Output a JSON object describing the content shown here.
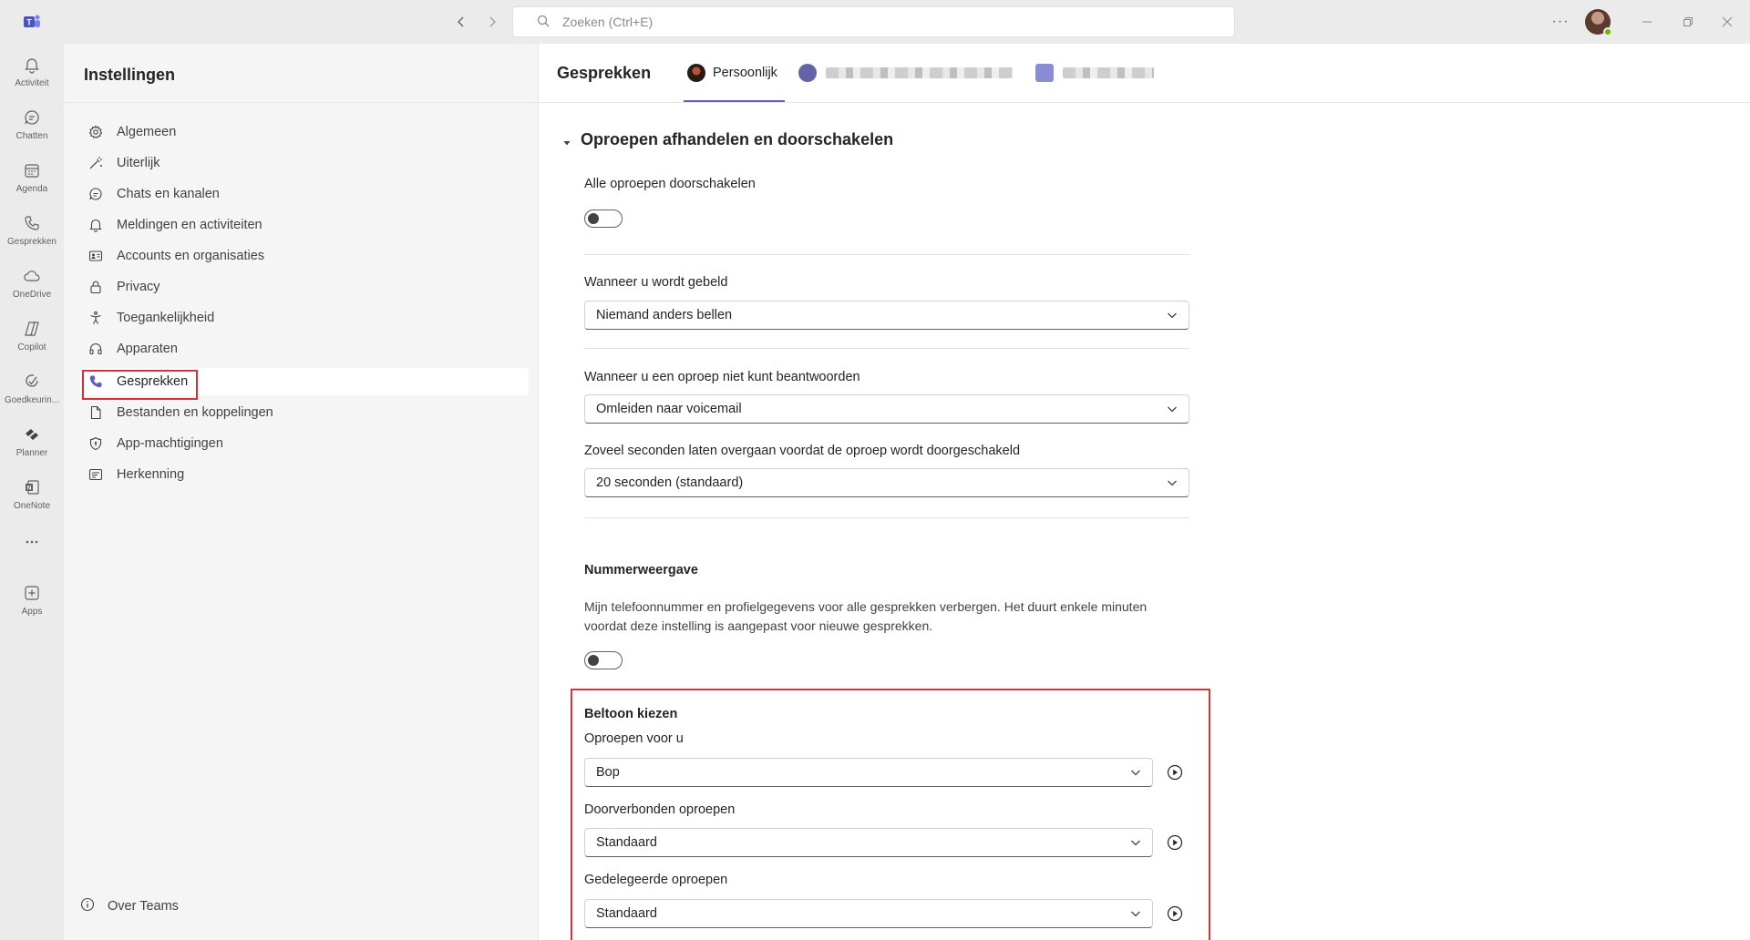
{
  "search": {
    "placeholder": "Zoeken (Ctrl+E)"
  },
  "rail": [
    {
      "label": "Activiteit",
      "icon": "bell-icon"
    },
    {
      "label": "Chatten",
      "icon": "chat-icon"
    },
    {
      "label": "Agenda",
      "icon": "calendar-icon"
    },
    {
      "label": "Gesprekken",
      "icon": "phone-icon"
    },
    {
      "label": "OneDrive",
      "icon": "cloud-icon"
    },
    {
      "label": "Copilot",
      "icon": "copilot-icon"
    },
    {
      "label": "Goedkeurin...",
      "icon": "approvals-icon"
    },
    {
      "label": "Planner",
      "icon": "planner-icon"
    },
    {
      "label": "OneNote",
      "icon": "onenote-icon"
    },
    {
      "label": "",
      "icon": "more-icon"
    },
    {
      "label": "Apps",
      "icon": "add-app-icon"
    }
  ],
  "settings_nav": {
    "title": "Instellingen",
    "items": [
      {
        "label": "Algemeen",
        "icon": "gear-icon"
      },
      {
        "label": "Uiterlijk",
        "icon": "wand-icon"
      },
      {
        "label": "Chats en kanalen",
        "icon": "chat-icon"
      },
      {
        "label": "Meldingen en activiteiten",
        "icon": "bell-icon"
      },
      {
        "label": "Accounts en organisaties",
        "icon": "contact-card-icon"
      },
      {
        "label": "Privacy",
        "icon": "lock-icon"
      },
      {
        "label": "Toegankelijkheid",
        "icon": "accessibility-icon"
      },
      {
        "label": "Apparaten",
        "icon": "headset-icon"
      },
      {
        "label": "Gesprekken",
        "icon": "phone-icon",
        "active": true
      },
      {
        "label": "Bestanden en koppelingen",
        "icon": "document-icon"
      },
      {
        "label": "App-machtigingen",
        "icon": "shield-icon"
      },
      {
        "label": "Herkenning",
        "icon": "recognition-icon"
      }
    ],
    "footer": {
      "label": "Over Teams",
      "icon": "info-icon"
    }
  },
  "main": {
    "title": "Gesprekken",
    "tabs": [
      {
        "label": "Persoonlijk"
      }
    ],
    "section": {
      "title": "Oproepen afhandelen en doorschakelen",
      "forward_all": {
        "label": "Alle oproepen doorschakelen",
        "on": false
      },
      "when_called": {
        "label": "Wanneer u wordt gebeld",
        "value": "Niemand anders bellen"
      },
      "when_unanswered": {
        "label": "Wanneer u een oproep niet kunt beantwoorden",
        "value": "Omleiden naar voicemail"
      },
      "ring_seconds": {
        "label": "Zoveel seconden laten overgaan voordat de oproep wordt doorgeschakeld",
        "value": "20 seconden (standaard)"
      },
      "caller_id": {
        "label": "Nummerweergave",
        "description_line1": "Mijn telefoonnummer en profielgegevens voor alle gesprekken verbergen. Het duurt enkele minuten",
        "description_line2": "voordat deze instelling is aangepast voor nieuwe gesprekken.",
        "on": false
      },
      "ringtone": {
        "title": "Beltoon kiezen",
        "for_you": {
          "label": "Oproepen voor u",
          "value": "Bop"
        },
        "forwarded": {
          "label": "Doorverbonden oproepen",
          "value": "Standaard"
        },
        "delegated": {
          "label": "Gedelegeerde oproepen",
          "value": "Standaard"
        }
      }
    }
  },
  "colors": {
    "accent": "#5b5fc7",
    "highlight": "#d13438"
  }
}
